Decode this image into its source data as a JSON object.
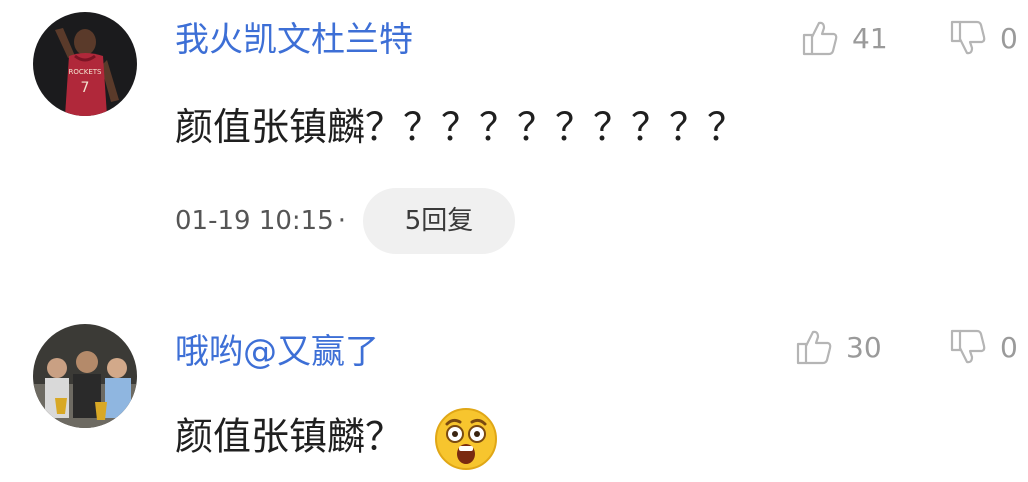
{
  "comments": [
    {
      "username": "我火凯文杜兰特",
      "content": "颜值张镇麟？？？？？？？？？？",
      "time": "01-19 10:15",
      "separator": "·",
      "replies": "5回复",
      "likes": "41",
      "dislikes": "0"
    },
    {
      "username": "哦哟@又赢了",
      "content": "颜值张镇麟？",
      "likes": "30",
      "dislikes": "0",
      "emoji": "astonished-face"
    }
  ],
  "colors": {
    "username": "#3d6fd6",
    "text": "#1f1f1f",
    "meta": "#555555",
    "count": "#9a9a9a",
    "pill": "#f0f0f0"
  }
}
